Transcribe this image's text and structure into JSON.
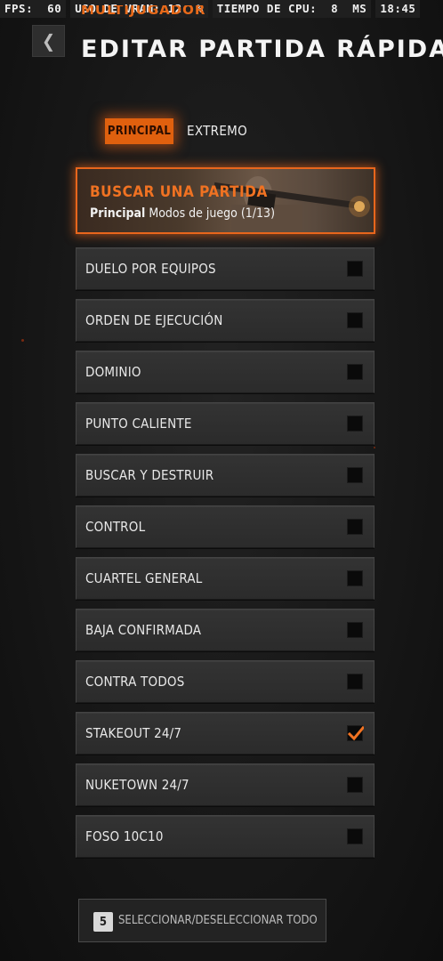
{
  "perf": {
    "fps_label": "FPS:",
    "fps_value": "60",
    "vram_label": "USO DE VRAM:",
    "vram_value": "12",
    "vram_unit": "%",
    "cpu_label": "TIEMPO DE CPU:",
    "cpu_value": "8",
    "cpu_unit": "MS",
    "clock": "18:45"
  },
  "header": {
    "subtitle": "MULTIJUGADOR",
    "title": "EDITAR PARTIDA RÁPIDA",
    "back_icon": "chevron-left-icon"
  },
  "tabs": [
    {
      "label": "PRINCIPAL",
      "active": true
    },
    {
      "label": "EXTREMO",
      "active": false
    }
  ],
  "find_match": {
    "title": "BUSCAR UNA PARTIDA",
    "sub_bold": "Principal",
    "sub_text": "Modos de juego (1/13)"
  },
  "modes": [
    {
      "label": "DUELO POR EQUIPOS",
      "checked": false
    },
    {
      "label": "ORDEN DE EJECUCIÓN",
      "checked": false
    },
    {
      "label": "DOMINIO",
      "checked": false
    },
    {
      "label": "PUNTO CALIENTE",
      "checked": false
    },
    {
      "label": "BUSCAR Y DESTRUIR",
      "checked": false
    },
    {
      "label": "CONTROL",
      "checked": false
    },
    {
      "label": "CUARTEL GENERAL",
      "checked": false
    },
    {
      "label": "BAJA CONFIRMADA",
      "checked": false
    },
    {
      "label": "CONTRA TODOS",
      "checked": false
    },
    {
      "label": "STAKEOUT 24/7",
      "checked": true
    },
    {
      "label": "NUKETOWN 24/7",
      "checked": false
    },
    {
      "label": "FOSO 10C10",
      "checked": false
    }
  ],
  "select_all": {
    "key": "5",
    "label": "SELECCIONAR/DESELECCIONAR TODO"
  },
  "colors": {
    "accent": "#e8661c",
    "check": "#f07222"
  }
}
